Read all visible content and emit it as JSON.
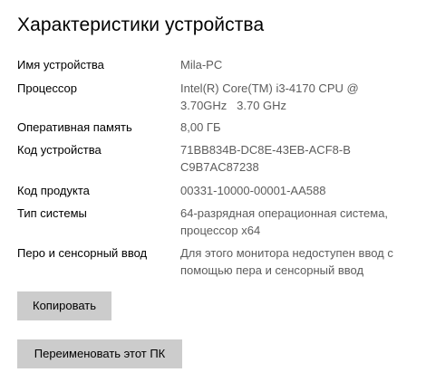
{
  "section": {
    "title": "Характеристики устройства"
  },
  "specs": [
    {
      "label": "Имя устройства",
      "value": "Mila-PC"
    },
    {
      "label": "Процессор",
      "value": "Intel(R) Core(TM) i3-4170 CPU @ 3.70GHz   3.70 GHz"
    },
    {
      "label": "Оперативная память",
      "value": "8,00 ГБ"
    },
    {
      "label": "Код устройства",
      "value": "71BB834B-DC8E-43EB-ACF8-BC9B7AC87238"
    },
    {
      "label": "Код продукта",
      "value": "00331-10000-00001-AA588"
    },
    {
      "label": "Тип системы",
      "value": "64-разрядная операционная система, процессор x64"
    },
    {
      "label": "Перо и сенсорный ввод",
      "value": "Для этого монитора недоступен ввод с помощью пера и сенсорный ввод"
    }
  ],
  "buttons": {
    "copy_label": "Копировать",
    "rename_label": "Переименовать этот ПК"
  }
}
